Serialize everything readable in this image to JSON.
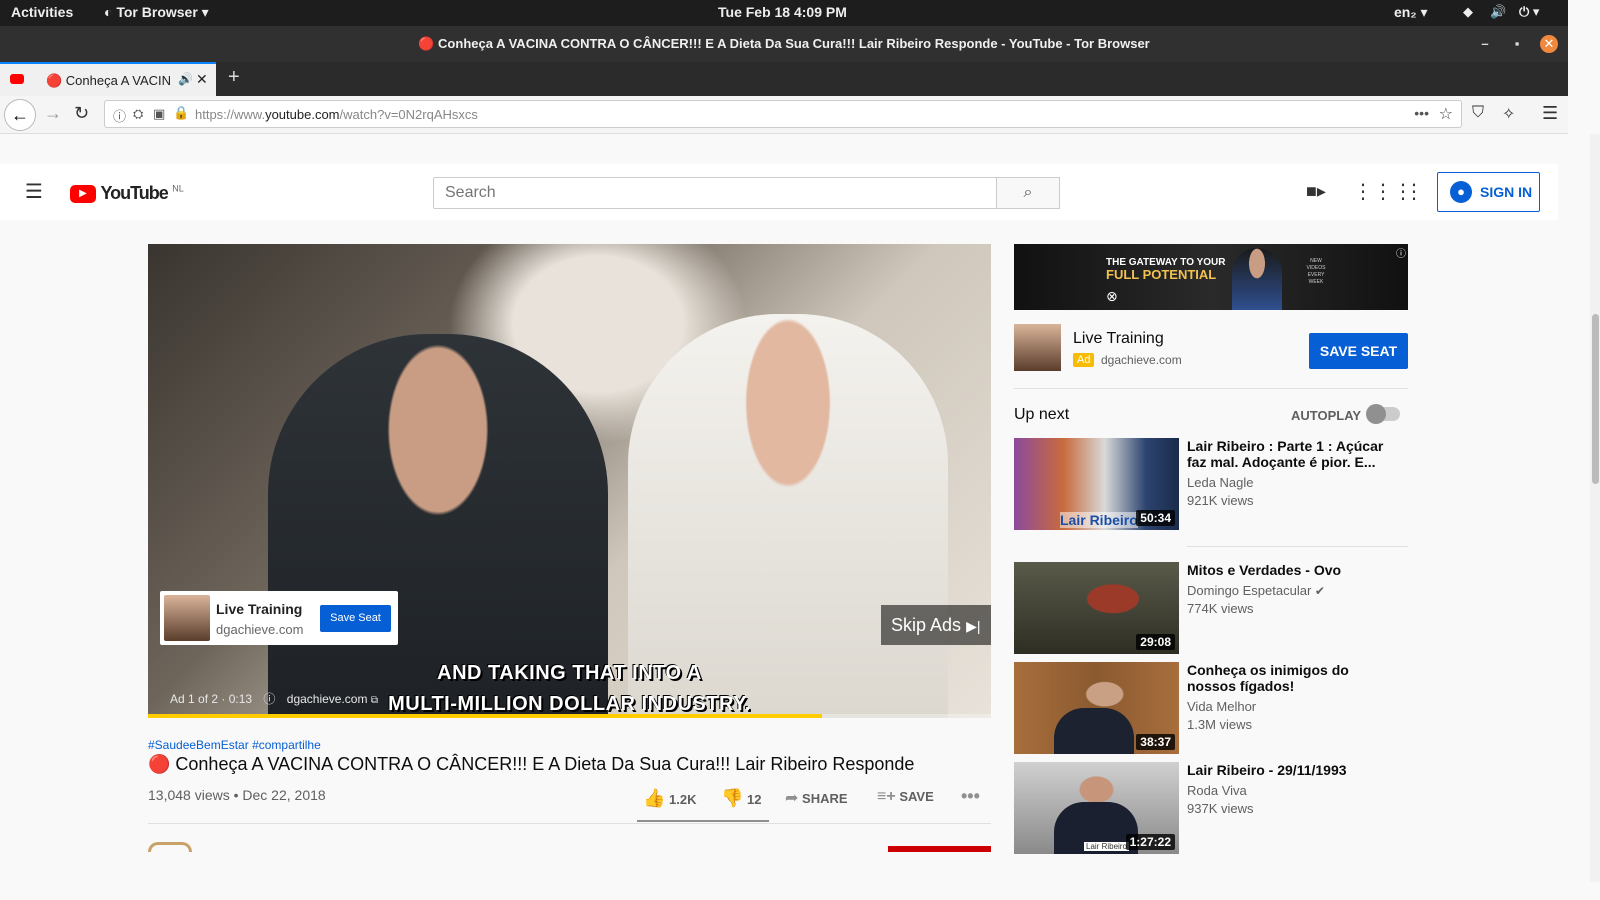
{
  "system": {
    "activities": "Activities",
    "app_menu": "Tor Browser",
    "clock": "Tue Feb 18   4:09 PM",
    "lang": "en₂"
  },
  "window": {
    "title": "🔴 Conheça A VACINA CONTRA O CÂNCER!!! E A Dieta Da Sua Cura!!! Lair Ribeiro Responde - YouTube - Tor Browser"
  },
  "tab": {
    "label": "🔴 Conheça A VACINA CONTRA O CÂNCER",
    "new_tab": "+"
  },
  "url": {
    "prefix": "https://www.",
    "domain": "youtube.com",
    "path": "/watch?v=0N2rqAHsxcs"
  },
  "youtube": {
    "logo_text": "YouTube",
    "logo_country": "NL",
    "search_placeholder": "Search",
    "sign_in": "SIGN IN"
  },
  "player": {
    "caption_line1": "AND TAKING THAT INTO A",
    "caption_line2": "MULTI-MILLION DOLLAR INDUSTRY.",
    "ad_card": {
      "title": "Live Training",
      "domain": "dgachieve.com",
      "button": "Save Seat"
    },
    "skip_label": "Skip Ads",
    "ad_counter": "Ad 1 of 2 · 0:13",
    "ad_link": "dgachieve.com",
    "progress": 0.8
  },
  "video": {
    "hashtags": "#SaudeeBemEstar #compartilhe",
    "title": "🔴 Conheça A VACINA CONTRA O CÂNCER!!! E A Dieta Da Sua Cura!!! Lair Ribeiro Responde",
    "views_date": "13,048 views • Dec 22, 2018",
    "likes": "1.2K",
    "dislikes": "12",
    "share": "SHARE",
    "save": "SAVE"
  },
  "banner_ad": {
    "text_line1": "THE GATEWAY TO YOUR",
    "text_line2": "FULL POTENTIAL",
    "side_text": "NEW VIDEOS EVERY WEEK"
  },
  "companion_ad": {
    "title": "Live Training",
    "badge": "Ad",
    "domain": "dgachieve.com",
    "button": "SAVE SEAT"
  },
  "up_next": {
    "heading": "Up next",
    "autoplay_label": "AUTOPLAY",
    "autoplay_on": false,
    "items": [
      {
        "title": "Lair Ribeiro : Parte 1 : Açúcar faz mal. Adoçante é pior. E...",
        "channel": "Leda Nagle",
        "views": "921K views",
        "duration": "50:34",
        "thumb_caption": "Lair Ribeiro"
      },
      {
        "title": "Mitos e Verdades - Ovo",
        "channel": "Domingo Espetacular",
        "views": "774K views",
        "duration": "29:08"
      },
      {
        "title": "Conheça os inimigos do nossos fígados!",
        "channel": "Vida Melhor",
        "views": "1.3M views",
        "duration": "38:37"
      },
      {
        "title": "Lair Ribeiro - 29/11/1993",
        "channel": "Roda Viva",
        "views": "937K views",
        "duration": "1:27:22",
        "thumb_caption": "Lair Ribeiro"
      }
    ]
  },
  "colors": {
    "youtube_red": "#ff0000",
    "blue": "#065fd4",
    "progress_yellow": "#ffcc00"
  }
}
